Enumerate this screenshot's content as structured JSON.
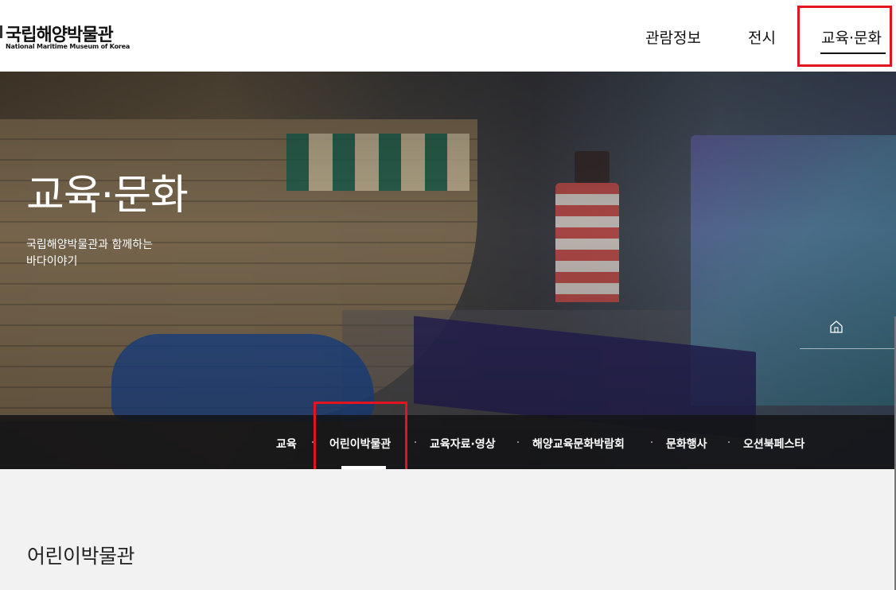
{
  "header": {
    "logo_ko": "국립해양박물관",
    "logo_en": "National Maritime Museum of Korea",
    "gnb": [
      "관람정보",
      "전시",
      "교육·문화"
    ]
  },
  "hero": {
    "title": "교육·문화",
    "subtitle_line1": "국립해양박물관과 함께하는",
    "subtitle_line2": "바다이야기"
  },
  "subnav": {
    "items": [
      "교육",
      "어린이박물관",
      "교육자료·영상",
      "해양교육문화박람회",
      "문화행사",
      "오션북페스타"
    ],
    "active_index": 1
  },
  "content": {
    "page_title": "어린이박물관"
  },
  "colors": {
    "highlight": "#e3141f",
    "nav_bar": "#141416",
    "content_bg": "#f2f2f2"
  },
  "icons": {
    "home": "home-icon"
  }
}
